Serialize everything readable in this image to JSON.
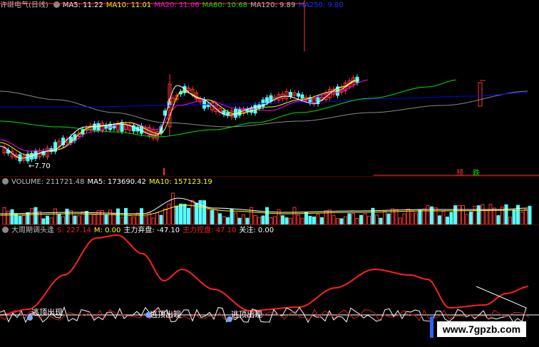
{
  "colors": {
    "bg": "#000000",
    "up": "#ff3232",
    "down": "#54ffff",
    "ma5": "#ffffff",
    "ma10": "#ffff00",
    "ma20": "#ff00ff",
    "ma60": "#00e600",
    "ma120": "#8a8a8a",
    "ma250": "#0000ff",
    "volume_label": "#c0c0c0",
    "risk_line": "#ff2020",
    "signal": "#ffd700"
  },
  "price_panel": {
    "stock_name": "许继电气(日线)",
    "ma5": "MA5: 11.22",
    "ma10": "MA10: 11.01",
    "ma20": "MA20: 11.06",
    "ma60": "MA60: 10.68",
    "ma120": "MA120: 9.89",
    "ma250": "MA250: 9.80",
    "low_marker": "←7.70",
    "signal_yu": "预",
    "signal_die": "跌"
  },
  "volume_panel": {
    "label": "VOLUME: 211721.48",
    "ma5": "MA5: 173690.42",
    "ma10": "MA10: 157123.19"
  },
  "indicator_panel": {
    "name": "大周期调头逢",
    "s": "S: 227.14",
    "m": "M: 0.00",
    "main_abandon": "主力弃盘: -47.10",
    "main_control": "主力控盘: 47.10",
    "attention": "关注: 0.00",
    "signals": [
      "逃顶出现",
      "逃顶出现",
      "逃顶出现"
    ]
  },
  "watermark": "www.7gpzb.com"
}
